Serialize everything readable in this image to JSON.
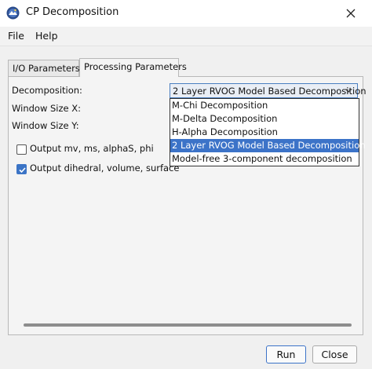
{
  "window": {
    "title": "CP Decomposition",
    "icon": "snap-logo-icon",
    "close_icon": "close-icon"
  },
  "menu": {
    "items": [
      "File",
      "Help"
    ]
  },
  "tabs": [
    {
      "label": "I/O Parameters",
      "active": false
    },
    {
      "label": "Processing Parameters",
      "active": true
    }
  ],
  "processing": {
    "decomposition_label": "Decomposition:",
    "decomposition_value": "2 Layer RVOG Model Based Decomposition",
    "window_x_label": "Window Size X:",
    "window_y_label": "Window Size Y:",
    "dropdown_options": [
      "M-Chi Decomposition",
      "M-Delta Decomposition",
      "H-Alpha Decomposition",
      "2 Layer RVOG Model Based Decomposition",
      "Model-free 3-component decomposition"
    ],
    "selected_option": "2 Layer RVOG Model Based Decomposition",
    "checkbox_mv": {
      "label": "Output mv, ms, alphaS, phi",
      "checked": false
    },
    "checkbox_dihedral": {
      "label": "Output dihedral, volume, surface",
      "checked": true
    }
  },
  "buttons": {
    "run_label": "Run",
    "close_label": "Close"
  },
  "colors": {
    "accent": "#3c73c8",
    "panel_bg": "#f0f0f0"
  }
}
